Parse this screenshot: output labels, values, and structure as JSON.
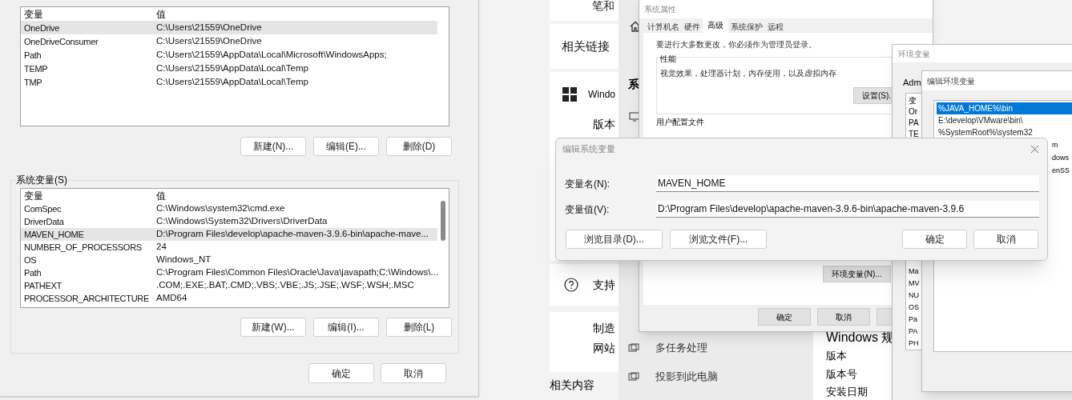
{
  "env_dialog": {
    "user_vars": {
      "columns": [
        "变量",
        "值"
      ],
      "rows": [
        {
          "name": "OneDrive",
          "value": "C:\\Users\\21559\\OneDrive",
          "selected": true
        },
        {
          "name": "OneDriveConsumer",
          "value": "C:\\Users\\21559\\OneDrive",
          "selected": false
        },
        {
          "name": "Path",
          "value": "C:\\Users\\21559\\AppData\\Local\\Microsoft\\WindowsApps;",
          "selected": false
        },
        {
          "name": "TEMP",
          "value": "C:\\Users\\21559\\AppData\\Local\\Temp",
          "selected": false
        },
        {
          "name": "TMP",
          "value": "C:\\Users\\21559\\AppData\\Local\\Temp",
          "selected": false
        }
      ]
    },
    "user_buttons": [
      "新建(N)...",
      "编辑(E)...",
      "删除(D)"
    ],
    "system_title": "系统变量(S)",
    "system_vars": {
      "columns": [
        "变量",
        "值"
      ],
      "rows": [
        {
          "name": "ComSpec",
          "value": "C:\\Windows\\system32\\cmd.exe",
          "selected": false
        },
        {
          "name": "DriverData",
          "value": "C:\\Windows\\System32\\Drivers\\DriverData",
          "selected": false
        },
        {
          "name": "MAVEN_HOME",
          "value": "D:\\Program Files\\develop\\apache-maven-3.9.6-bin\\apache-mave...",
          "selected": true
        },
        {
          "name": "NUMBER_OF_PROCESSORS",
          "value": "24",
          "selected": false
        },
        {
          "name": "OS",
          "value": "Windows_NT",
          "selected": false
        },
        {
          "name": "Path",
          "value": "C:\\Program Files\\Common Files\\Oracle\\Java\\javapath;C:\\Windows\\...",
          "selected": false
        },
        {
          "name": "PATHEXT",
          "value": ".COM;.EXE;.BAT;.CMD;.VBS;.VBE;.JS;.JSE;.WSF;.WSH;.MSC",
          "selected": false
        },
        {
          "name": "PROCESSOR_ARCHITECTURE",
          "value": "AMD64",
          "selected": false
        }
      ]
    },
    "system_buttons": [
      "新建(W)...",
      "编辑(I)...",
      "删除(L)"
    ],
    "footer_buttons": [
      "确定",
      "取消"
    ]
  },
  "settings": {
    "cards": [
      "笔和",
      "相关链接",
      "Windo",
      "版本",
      "支持",
      "制造",
      "网站"
    ],
    "related": "相关内容",
    "nav": {
      "cut_label": "系",
      "items": [
        "多任务处理",
        "投影到此电脑"
      ]
    },
    "specs": {
      "title": "Windows 规",
      "rows": [
        "版本",
        "版本号",
        "安装日期"
      ]
    }
  },
  "system_properties": {
    "title": "系统属性",
    "tabs": [
      {
        "label": "计算机名",
        "selected": false
      },
      {
        "label": "硬件",
        "selected": false
      },
      {
        "label": "高级",
        "selected": true
      },
      {
        "label": "系统保护",
        "selected": false
      },
      {
        "label": "远程",
        "selected": false
      }
    ],
    "admin_note": "要进行大多数更改，你必须作为管理员登录。",
    "performance": {
      "title": "性能",
      "text": "视觉效果，处理器计划，内存使用，以及虚拟内存",
      "button": "设置(S)."
    },
    "profile_title": "用户配置文件",
    "env_button": "环境变量(N)...",
    "buttons": [
      "确定",
      "取消"
    ]
  },
  "env_window": {
    "title": "环境变量",
    "section": "Adm",
    "top_rows": [
      "变",
      "Or",
      "PA",
      "TE"
    ],
    "bottom_rows": [
      "Ma",
      "MV",
      "NU",
      "OS",
      "Pa",
      "PA",
      "PH"
    ]
  },
  "edit_env_window": {
    "title": "编辑环境变量",
    "items": [
      {
        "text": "%JAVA_HOME%\\bin",
        "selected": true
      },
      {
        "text": "E:\\develop\\VMware\\bin\\",
        "selected": false
      },
      {
        "text": "%SystemRoot%\\system32",
        "selected": false
      }
    ],
    "fragments": [
      "m",
      "dows",
      "enSS"
    ]
  },
  "edit_dialog": {
    "title": "编辑系统变量",
    "fields": [
      {
        "label": "变量名(N):",
        "value": "MAVEN_HOME"
      },
      {
        "label": "变量值(V):",
        "value": "D:\\Program Files\\develop\\apache-maven-3.9.6-bin\\apache-maven-3.9.6"
      }
    ],
    "left_buttons": [
      "浏览目录(D)...",
      "浏览文件(F)..."
    ],
    "right_buttons": [
      "确定",
      "取消"
    ]
  }
}
